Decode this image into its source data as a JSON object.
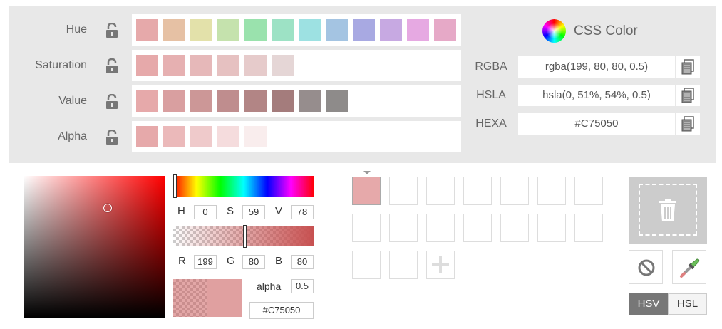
{
  "rows": [
    {
      "label": "Hue",
      "swatches": [
        "#e6a9aa",
        "#e6c1a4",
        "#e3e1aa",
        "#c5e2ad",
        "#9ae2ad",
        "#9de2c5",
        "#9de1e2",
        "#a4c4e2",
        "#a8a9e2",
        "#c7a9e2",
        "#e6a9e2",
        "#e6a9c7"
      ]
    },
    {
      "label": "Saturation",
      "swatches": [
        "#e6a9aa",
        "#e6b0b1",
        "#e6b8b9",
        "#e6c1c1",
        "#e6cbcb",
        "#e5d6d6"
      ]
    },
    {
      "label": "Value",
      "swatches": [
        "#e6a9aa",
        "#d99fa0",
        "#cc9797",
        "#bf8d8e",
        "#b28585",
        "#a47c7c",
        "#968d8d",
        "#8e8b8a"
      ]
    },
    {
      "label": "Alpha",
      "swatches": [
        "#e6a9aa",
        "#ebb9ba",
        "#efcacb",
        "#f5dcdd",
        "#f9eded"
      ]
    }
  ],
  "css_title": "CSS Color",
  "formats": [
    {
      "label": "RGBA",
      "value": "rgba(199, 80, 80, 0.5)"
    },
    {
      "label": "HSLA",
      "value": "hsla(0, 51%, 54%, 0.5)"
    },
    {
      "label": "HEXA",
      "value": "#C75050"
    }
  ],
  "hsv": {
    "h_label": "H",
    "h": "0",
    "s_label": "S",
    "s": "59",
    "v_label": "V",
    "v": "78"
  },
  "rgb": {
    "r_label": "R",
    "r": "199",
    "g_label": "G",
    "g": "80",
    "b_label": "B",
    "b": "80"
  },
  "alpha": {
    "label": "alpha",
    "value": "0.5"
  },
  "hex": "#C75050",
  "palette": {
    "filled_color": "#e6a9aa",
    "empty_slots": 16
  },
  "modes": {
    "hsv": "HSV",
    "hsl": "HSL",
    "active": "HSV"
  }
}
